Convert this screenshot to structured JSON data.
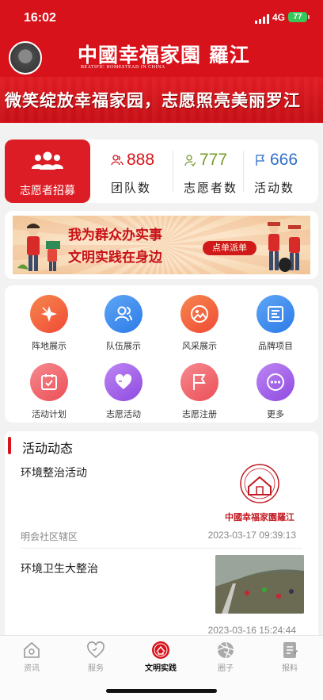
{
  "status_bar": {
    "time": "16:02",
    "network": "4G",
    "battery": "77"
  },
  "header": {
    "logo_text": "中國幸福家園 羅江",
    "logo_subtitle": "BEATIFIC HOMESTEAD IN CHINA",
    "slogan": "微笑绽放幸福家园，志愿照亮美丽罗江"
  },
  "stats": {
    "recruit_label": "志愿者招募",
    "items": [
      {
        "value": "888",
        "label": "团队数",
        "color": "#d8121a",
        "icon": "team-icon"
      },
      {
        "value": "777",
        "label": "志愿者数",
        "color": "#7a9a2e",
        "icon": "volunteer-icon"
      },
      {
        "value": "666",
        "label": "活动数",
        "color": "#2f6ec8",
        "icon": "flag-icon"
      }
    ]
  },
  "banner": {
    "line1": "我为群众办实事",
    "line2": "文明实践在身边",
    "button": "点单派单"
  },
  "grid": [
    {
      "label": "阵地展示",
      "icon": "position-icon",
      "color": "#f4613c"
    },
    {
      "label": "队伍展示",
      "icon": "team-show-icon",
      "color": "#3d8ef0"
    },
    {
      "label": "风采展示",
      "icon": "photo-icon",
      "color": "#f4613c"
    },
    {
      "label": "品牌项目",
      "icon": "brand-icon",
      "color": "#3d8ef0"
    },
    {
      "label": "活动计划",
      "icon": "plan-icon",
      "color": "#ef6468"
    },
    {
      "label": "志愿活动",
      "icon": "heart-icon",
      "color": "#a05ce8"
    },
    {
      "label": "志愿注册",
      "icon": "register-flag-icon",
      "color": "#ef6468"
    },
    {
      "label": "更多",
      "icon": "more-icon",
      "color": "#a05ce8"
    }
  ],
  "activity": {
    "title": "活动动态",
    "items": [
      {
        "title": "环境整治活动",
        "source": "明会社区辖区",
        "time": "2023-03-17 09:39:13"
      },
      {
        "title": "环境卫生大整治",
        "source": "",
        "time": "2023-03-16 15:24:44"
      }
    ]
  },
  "tabs": [
    {
      "label": "资讯",
      "icon": "news-house-icon",
      "active": false
    },
    {
      "label": "服务",
      "icon": "service-heart-icon",
      "active": false
    },
    {
      "label": "文明实践",
      "icon": "civilization-icon",
      "active": true
    },
    {
      "label": "圈子",
      "icon": "circle-icon",
      "active": false
    },
    {
      "label": "报料",
      "icon": "report-icon",
      "active": false
    }
  ],
  "colors": {
    "brand_red": "#d8121a",
    "accent_blue": "#2f6ec8",
    "accent_green": "#7a9a2e"
  }
}
